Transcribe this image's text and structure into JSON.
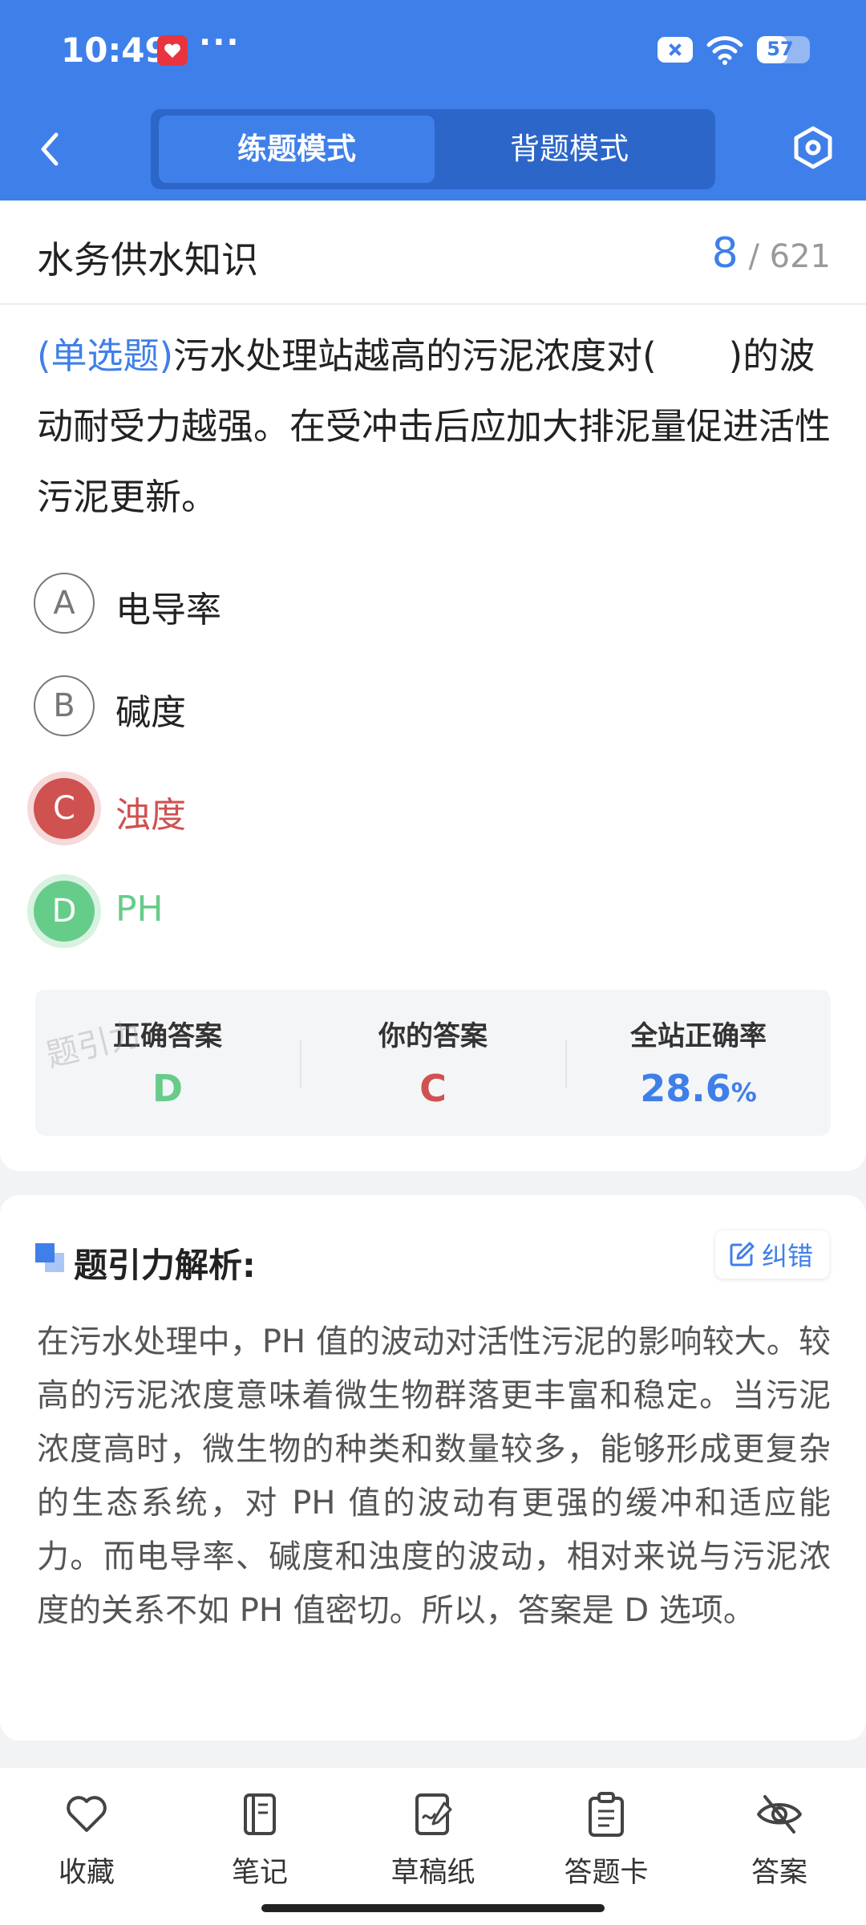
{
  "status_bar": {
    "time": "10:49",
    "more": "···",
    "battery_percent": "57",
    "battery_level": 0.57
  },
  "nav": {
    "modes": [
      "练题模式",
      "背题模式"
    ],
    "active_mode_index": 0
  },
  "topic": {
    "title": "水务供水知识",
    "current": "8",
    "separator": "/",
    "total": "621"
  },
  "question": {
    "type": "(单选题)",
    "text": "污水处理站越高的污泥浓度对(　　)的波动耐受力越强。在受冲击后应加大排泥量促进活性污泥更新。",
    "options": [
      {
        "letter": "A",
        "text": "电导率",
        "state": "normal"
      },
      {
        "letter": "B",
        "text": "碱度",
        "state": "normal"
      },
      {
        "letter": "C",
        "text": "浊度",
        "state": "wrong"
      },
      {
        "letter": "D",
        "text": "PH",
        "state": "right"
      }
    ]
  },
  "stats": {
    "correct_label": "正确答案",
    "correct_value": "D",
    "yours_label": "你的答案",
    "yours_value": "C",
    "rate_label": "全站正确率",
    "rate_value": "28.6",
    "rate_unit": "%",
    "watermark": "题引力"
  },
  "analysis": {
    "title": "题引力解析:",
    "report_label": "纠错",
    "text": "在污水处理中，PH 值的波动对活性污泥的影响较大。较高的污泥浓度意味着微生物群落更丰富和稳定。当污泥浓度高时，微生物的种类和数量较多，能够形成更复杂的生态系统，对 PH 值的波动有更强的缓冲和适应能力。而电导率、碱度和浊度的波动，相对来说与污泥浓度的关系不如 PH 值密切。所以，答案是 D 选项。"
  },
  "bottom_bar": {
    "items": [
      {
        "label": "收藏",
        "icon": "heart-icon"
      },
      {
        "label": "笔记",
        "icon": "notebook-icon"
      },
      {
        "label": "草稿纸",
        "icon": "draft-paper-icon"
      },
      {
        "label": "答题卡",
        "icon": "clipboard-icon"
      },
      {
        "label": "答案",
        "icon": "eye-off-icon"
      }
    ]
  },
  "colors": {
    "brand_blue": "#3f7fe9",
    "wrong_red": "#cf5150",
    "right_green": "#66cc8a"
  }
}
